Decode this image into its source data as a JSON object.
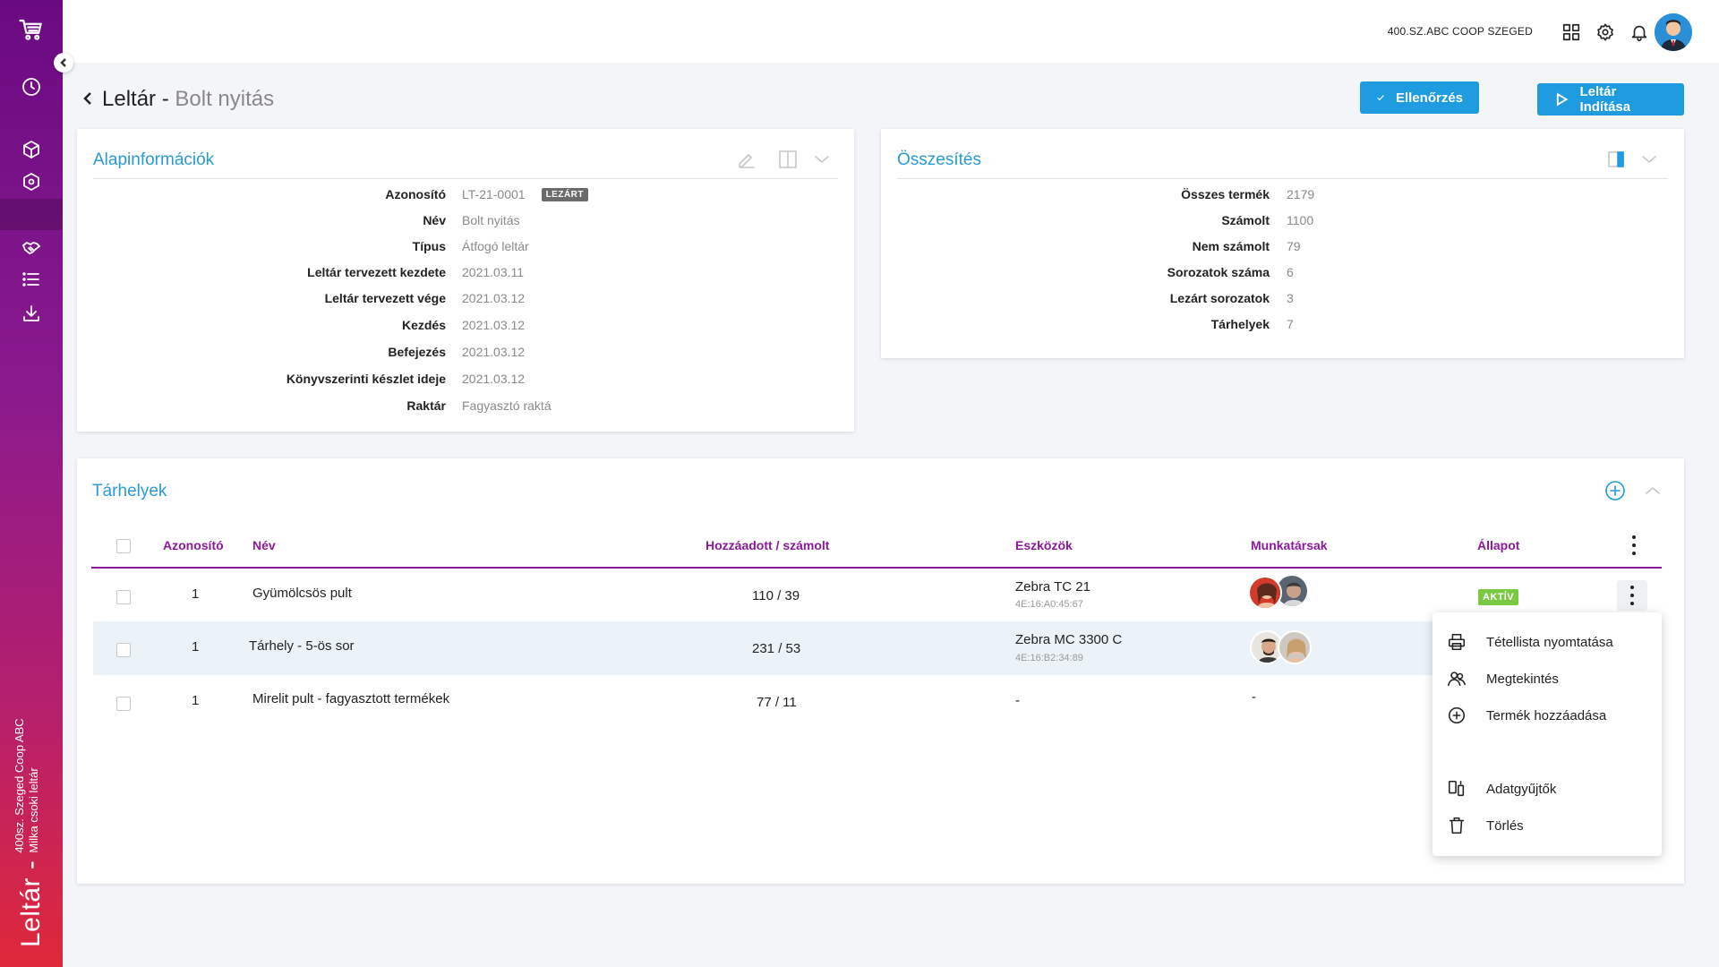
{
  "sidebar": {
    "vertical_title": "Leltár -",
    "vertical_sub_1": "400sz. Szeged Coop ABC",
    "vertical_sub_2": "Milka csoki leltár",
    "icons": [
      "cart-icon",
      "clock-icon",
      "box-icon",
      "box-settings-icon",
      "handshake-icon",
      "list-icon",
      "download-icon"
    ]
  },
  "topbar": {
    "store_name": "400.SZ.ABC COOP SZEGED",
    "icons": [
      "grid-icon",
      "gear-icon",
      "bell-icon"
    ]
  },
  "header": {
    "title": "Leltár",
    "separator": " - ",
    "subtitle": "Bolt nyitás",
    "btn_check": "Ellenőrzés",
    "btn_start": "Leltár Indítása"
  },
  "basic_info": {
    "title": "Alapinformációk",
    "rows": [
      {
        "label": "Azonosító",
        "value": "LT-21-0001",
        "badge": "LEZÁRT"
      },
      {
        "label": "Név",
        "value": "Bolt nyitás"
      },
      {
        "label": "Típus",
        "value": "Átfogó leltár"
      },
      {
        "label": "Leltár tervezett kezdete",
        "value": "2021.03.11"
      },
      {
        "label": "Leltár tervezett vége",
        "value": "2021.03.12"
      },
      {
        "label": "Kezdés",
        "value": "2021.03.12"
      },
      {
        "label": "Befejezés",
        "value": "2021.03.12"
      },
      {
        "label": "Könyvszerinti készlet ideje",
        "value": "2021.03.12"
      },
      {
        "label": "Raktár",
        "value": "Fagyasztó raktá"
      }
    ]
  },
  "summary": {
    "title": "Összesítés",
    "rows": [
      {
        "label": "Összes termék",
        "value": "2179"
      },
      {
        "label": "Számolt",
        "value": "1100"
      },
      {
        "label": "Nem számolt",
        "value": "79"
      },
      {
        "label": "Sorozatok száma",
        "value": "6"
      },
      {
        "label": "Lezárt sorozatok",
        "value": "3"
      },
      {
        "label": "Tárhelyek",
        "value": "7"
      }
    ]
  },
  "storage": {
    "title": "Tárhelyek",
    "columns": {
      "id": "Azonosító",
      "name": "Név",
      "counted": "Hozzáadott / számolt",
      "devices": "Eszközök",
      "staff": "Munkatársak",
      "status": "Állapot"
    },
    "rows": [
      {
        "id": "1",
        "name": "Gyümölcsös pult",
        "counted": "110 / 39",
        "device": "Zebra TC 21",
        "device_mac": "4E:16:A0:45:67",
        "status": "AKTÍV"
      },
      {
        "id": "1",
        "name": "Tárhely - 5-ös sor",
        "counted": "231 / 53",
        "device": "Zebra MC 3300 C",
        "device_mac": "4E:16:B2:34:89",
        "status": ""
      },
      {
        "id": "1",
        "name": "Mirelit pult - fagyasztott termékek",
        "counted": "77 / 11",
        "device": "-",
        "device_mac": "",
        "staff": "-",
        "status": ""
      }
    ]
  },
  "menu": {
    "items": [
      {
        "label": "Tétellista nyomtatása",
        "icon": "printer-icon"
      },
      {
        "label": "Megtekintés",
        "icon": "users-icon"
      },
      {
        "label": "Termék hozzáadása",
        "icon": "plus-circle-icon"
      },
      {
        "label": "Adatgyűjtők",
        "icon": "devices-icon"
      },
      {
        "label": "Törlés",
        "icon": "trash-icon"
      }
    ]
  },
  "colors": {
    "accent_blue": "#1f9be0",
    "title_blue": "#2a9ad6",
    "header_purple": "#8a1a9a",
    "active_green": "#7ac943"
  }
}
